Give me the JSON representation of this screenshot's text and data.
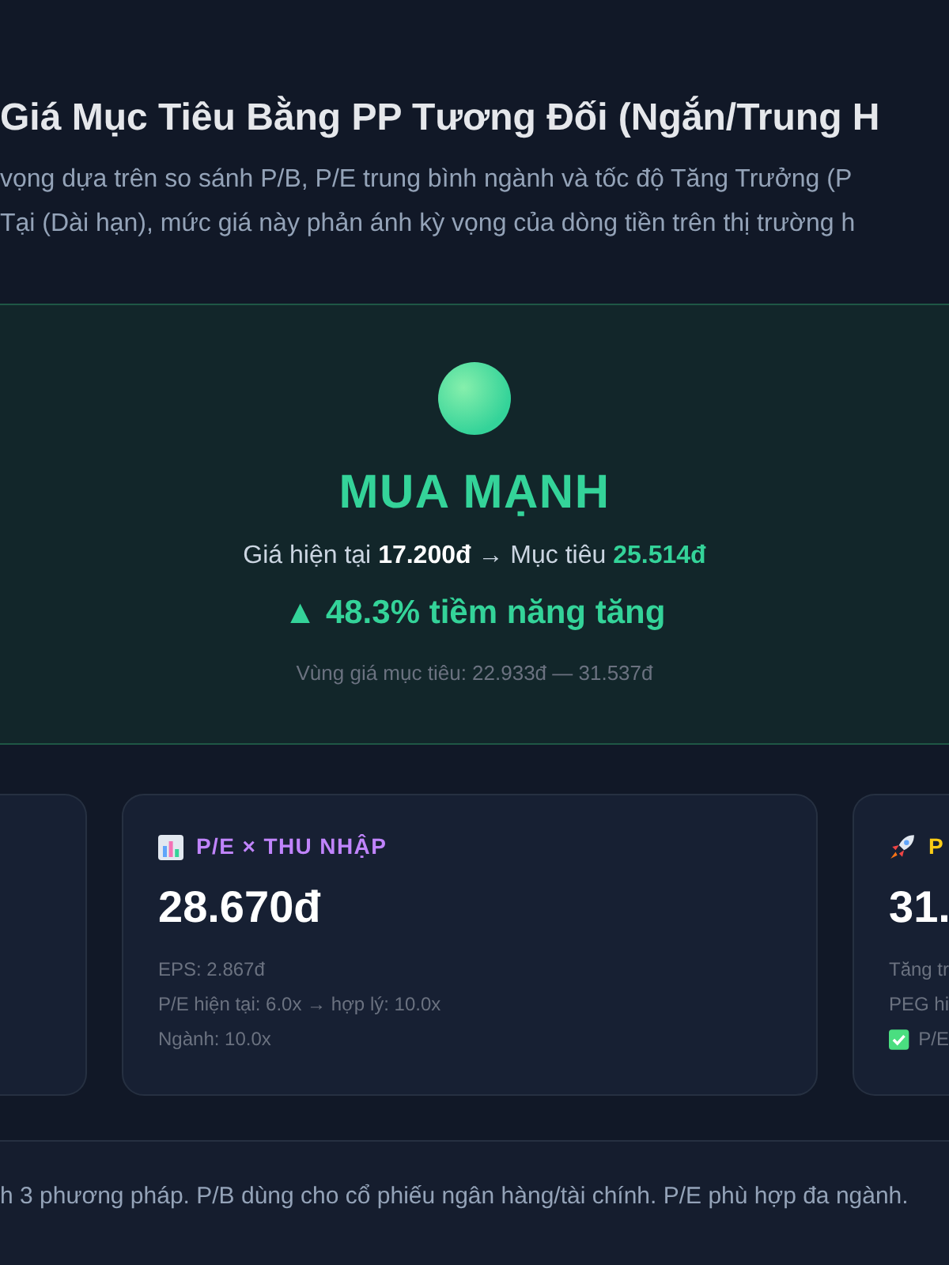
{
  "header": {
    "title": "Giá Mục Tiêu Bằng PP Tương Đối (Ngắn/Trung H",
    "description": [
      "vọng dựa trên so sánh P/B, P/E trung bình ngành và tốc độ Tăng Trưởng (P",
      "Tại (Dài hạn), mức giá này phản ánh kỳ vọng của dòng tiền trên thị trường h"
    ]
  },
  "verdict": {
    "label": "MUA MẠNH",
    "price_line": "Giá hiện tại **17.200đ** → Mục tiêu **25.514đ**",
    "upside": "▲ 48.3% tiềm năng tăng",
    "range": "Vùng giá mục tiêu: 22.933đ — 31.537đ"
  },
  "methods": [
    {
      "kind": "chart",
      "title": "P/E × THU NHẬP",
      "color": "#c084fc",
      "value": "28.670đ",
      "notes": [
        {
          "text": "EPS: 2.867đ",
          "check": false
        },
        {
          "text": "P/E hiện tại: 6.0x → hợp lý: 10.0x",
          "check": false
        },
        {
          "text": "Ngành: 10.0x",
          "check": false
        }
      ]
    },
    {
      "kind": "rocket",
      "title": "P",
      "color": "#facc15",
      "value": "31.",
      "notes": [
        {
          "text": "Tăng tr",
          "check": false
        },
        {
          "text": "PEG hi",
          "check": false
        },
        {
          "text": "P/E",
          "check": true
        }
      ]
    }
  ],
  "footer": {
    "note": "h 3 phương pháp. P/B dùng cho cổ phiếu ngân hàng/tài chính. P/E phù hợp đa ngành."
  }
}
